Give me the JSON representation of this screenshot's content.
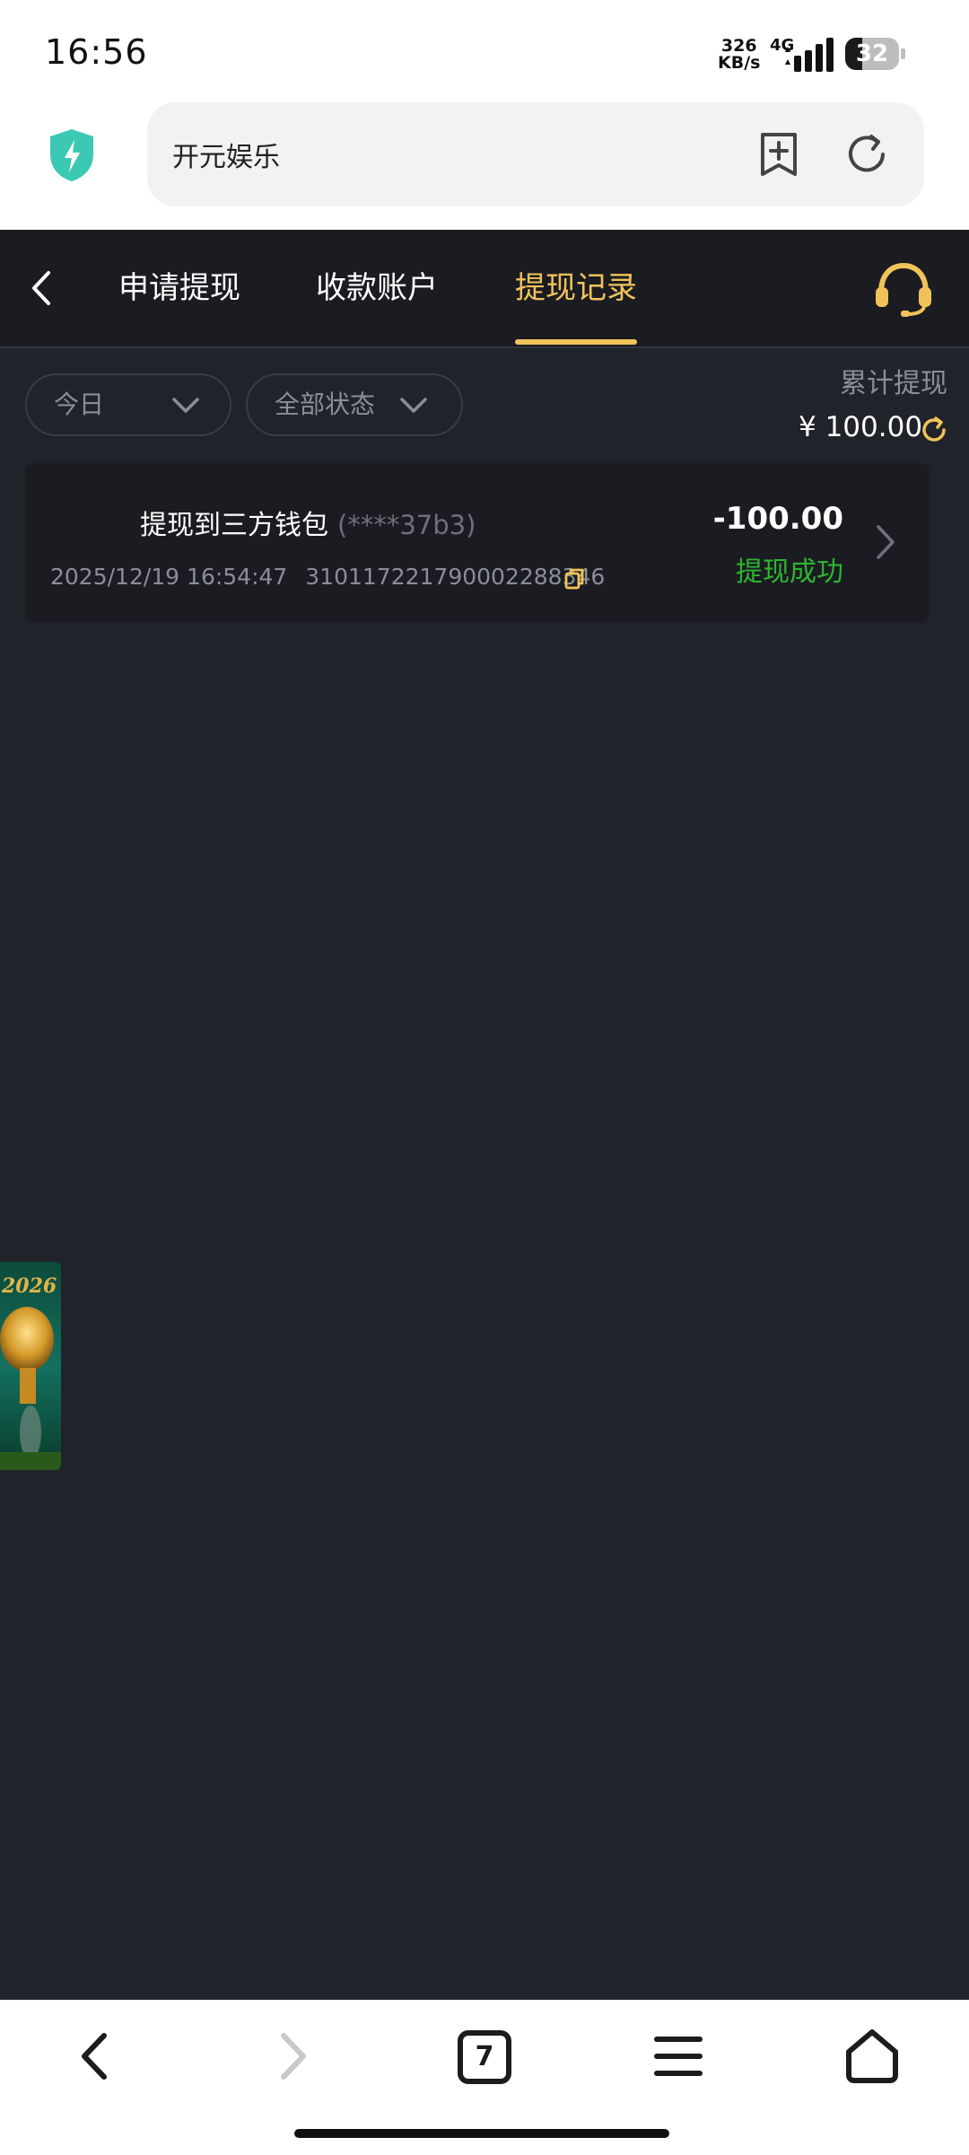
{
  "status_bar": {
    "time": "16:56",
    "net_speed_value": "326",
    "net_speed_unit": "KB/s",
    "network": "4G",
    "battery": "32",
    "battery_level": 0.32
  },
  "browser": {
    "address_text": "开元娱乐",
    "open_tabs_count": "7"
  },
  "tabs": [
    {
      "label": "申请提现",
      "active": false
    },
    {
      "label": "收款账户",
      "active": false
    },
    {
      "label": "提现记录",
      "active": true
    }
  ],
  "filters": {
    "date": "今日",
    "status": "全部状态"
  },
  "summary": {
    "label": "累计提现",
    "value": "¥ 100.00"
  },
  "records": [
    {
      "title": "提现到三方钱包",
      "account_mask": "(****37b3)",
      "datetime": "2025/12/19 16:54:47",
      "order_id": "310117221790002288346",
      "amount": "-100.00",
      "status": "提现成功"
    }
  ],
  "promo": {
    "year_text": "2026"
  },
  "colors": {
    "accent": "#f0c35a",
    "success": "#2bb62f",
    "background": "#21232a"
  }
}
